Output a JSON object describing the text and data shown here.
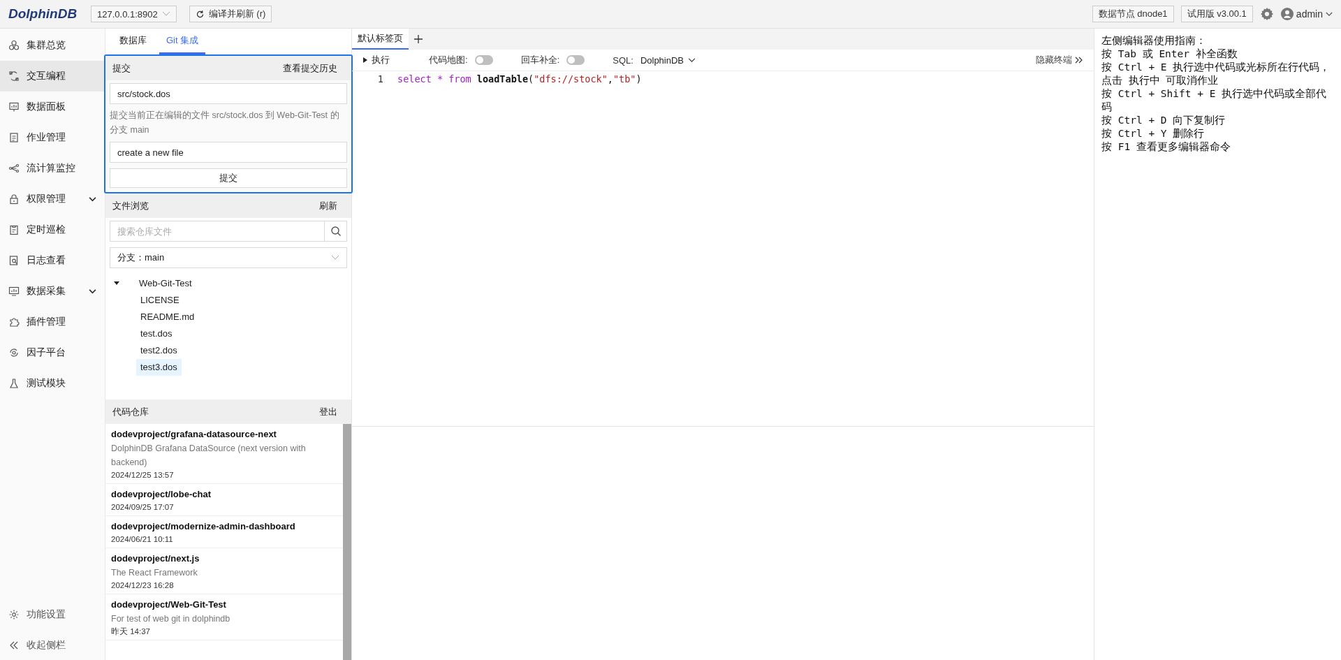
{
  "header": {
    "logo": "DolphinDB",
    "server": "127.0.0.1:8902",
    "refresh_button": "编译并刷新 (r)",
    "node_badge": "数据节点 dnode1",
    "version_badge": "试用版 v3.00.1",
    "user": "admin"
  },
  "sidebar": {
    "items": [
      {
        "label": "集群总览",
        "selected": false,
        "expandable": false
      },
      {
        "label": "交互编程",
        "selected": true,
        "expandable": false
      },
      {
        "label": "数据面板",
        "selected": false,
        "expandable": false
      },
      {
        "label": "作业管理",
        "selected": false,
        "expandable": false
      },
      {
        "label": "流计算监控",
        "selected": false,
        "expandable": false
      },
      {
        "label": "权限管理",
        "selected": false,
        "expandable": true
      },
      {
        "label": "定时巡检",
        "selected": false,
        "expandable": false
      },
      {
        "label": "日志查看",
        "selected": false,
        "expandable": false
      },
      {
        "label": "数据采集",
        "selected": false,
        "expandable": true
      },
      {
        "label": "插件管理",
        "selected": false,
        "expandable": false
      },
      {
        "label": "因子平台",
        "selected": false,
        "expandable": false
      },
      {
        "label": "测试模块",
        "selected": false,
        "expandable": false
      }
    ],
    "footer": [
      {
        "label": "功能设置"
      },
      {
        "label": "收起侧栏"
      }
    ]
  },
  "left_panel": {
    "tabs": [
      {
        "label": "数据库",
        "selected": false
      },
      {
        "label": "Git 集成",
        "selected": true
      }
    ],
    "commit": {
      "title": "提交",
      "history_link": "查看提交历史",
      "file_path": "src/stock.dos",
      "description": "提交当前正在编辑的文件 src/stock.dos 到 Web-Git-Test 的分支 main",
      "message": "create a new file",
      "submit_button": "提交"
    },
    "files": {
      "title": "文件浏览",
      "refresh": "刷新",
      "search": {
        "placeholder": "搜索仓库文件"
      },
      "branch": "分支：main",
      "tree": [
        {
          "name": "Web-Git-Test",
          "expanded": true,
          "selected": false,
          "children": [
            {
              "name": "LICENSE",
              "selected": false
            },
            {
              "name": "README.md",
              "selected": false
            },
            {
              "name": "test.dos",
              "selected": false
            },
            {
              "name": "test2.dos",
              "selected": false
            },
            {
              "name": "test3.dos",
              "selected": true
            }
          ]
        }
      ]
    },
    "repos": {
      "title": "代码仓库",
      "logout": "登出",
      "items": [
        {
          "name": "dodevproject/grafana-datasource-next",
          "description": "DolphinDB Grafana DataSource (next version with backend)",
          "time": "2024/12/25 13:57"
        },
        {
          "name": "dodevproject/lobe-chat",
          "time": "2024/09/25 17:07"
        },
        {
          "name": "dodevproject/modernize-admin-dashboard",
          "time": "2024/06/21 10:11"
        },
        {
          "name": "dodevproject/next.js",
          "description": "The React Framework",
          "time": "2024/12/23 16:28"
        },
        {
          "name": "dodevproject/Web-Git-Test",
          "description": "For test of web git in dolphindb",
          "time": "昨天 14:37"
        }
      ]
    }
  },
  "editor": {
    "tabs": [
      {
        "label": "默认标签页",
        "selected": true
      }
    ],
    "toolbar": {
      "run": "执行",
      "minimap": {
        "label": "代码地图:",
        "on": false
      },
      "autocomplete": {
        "label": "回车补全:",
        "on": false
      },
      "sql_label": "SQL:",
      "sql_dialect": "DolphinDB",
      "hide_terminal": "隐藏终端"
    },
    "lines": [
      {
        "number": "1",
        "tokens": [
          {
            "kind": "keyword",
            "text": "select"
          },
          {
            "kind": "keyword",
            "text": "*"
          },
          {
            "kind": "keyword",
            "text": "from"
          },
          {
            "kind": "function",
            "text": "loadTable"
          },
          {
            "kind": "plain",
            "text": "("
          },
          {
            "kind": "string",
            "text": "\"dfs://stock\""
          },
          {
            "kind": "plain",
            "text": ","
          },
          {
            "kind": "string",
            "text": "\"tb\""
          },
          {
            "kind": "plain",
            "text": ")"
          }
        ]
      }
    ]
  },
  "guide": {
    "lines": [
      "左侧编辑器使用指南：",
      "按 Tab 或 Enter 补全函数",
      "按 Ctrl + E 执行选中代码或光标所在行代码，点击 执行中 可取消作业",
      "按 Ctrl + Shift + E 执行选中代码或全部代码",
      "按 Ctrl + D 向下复制行",
      "按 Ctrl + Y 删除行",
      "按 F1 查看更多编辑器命令"
    ]
  }
}
